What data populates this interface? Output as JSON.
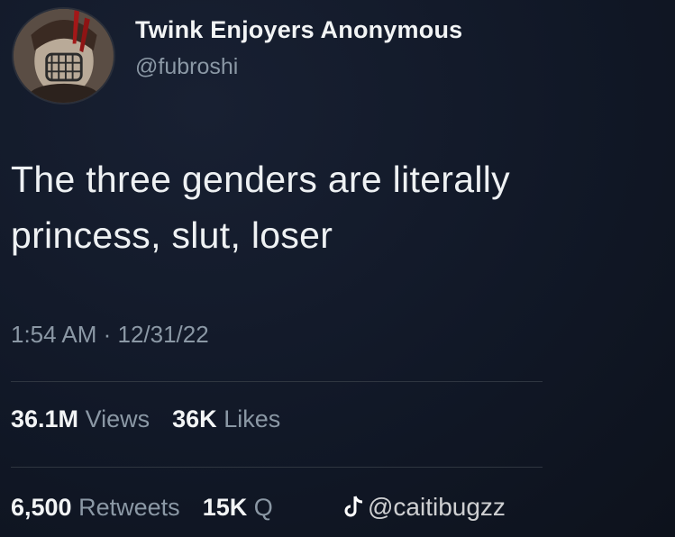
{
  "tweet": {
    "display_name": "Twink Enjoyers Anonymous",
    "handle": "@fubroshi",
    "text_line1": "The three genders are literally",
    "text_line2": "princess, slut, loser",
    "timestamp": "1:54 AM · 12/31/22"
  },
  "stats": {
    "views_count": "36.1M",
    "views_label": "Views",
    "likes_count": "36K",
    "likes_label": "Likes",
    "retweets_count": "6,500",
    "retweets_label": "Retweets",
    "quotes_count": "15K",
    "quotes_label": "Q"
  },
  "watermark": {
    "icon": "tiktok-icon",
    "text": "@caitibugzz"
  },
  "colors": {
    "background": "#0f1520",
    "primary_text": "#eef1f3",
    "secondary_text": "#8b98a5"
  }
}
